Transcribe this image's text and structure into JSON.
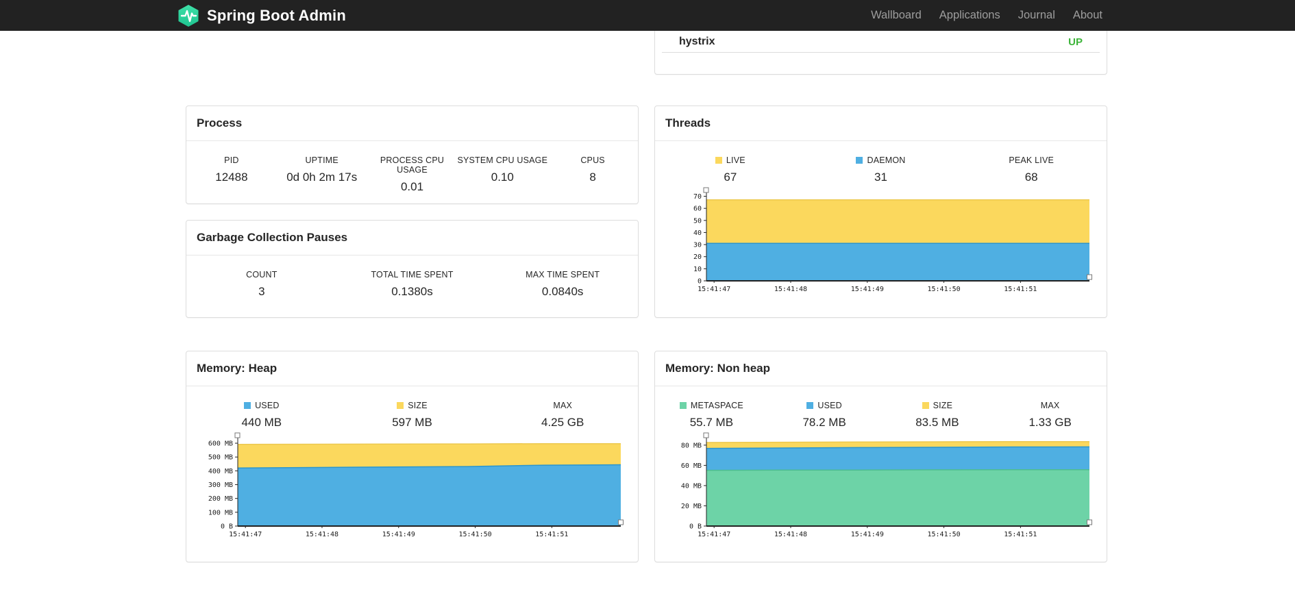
{
  "navbar": {
    "brand": "Spring Boot Admin",
    "links": [
      {
        "label": "Wallboard"
      },
      {
        "label": "Applications"
      },
      {
        "label": "Journal"
      },
      {
        "label": "About"
      }
    ]
  },
  "colors": {
    "accent_teal": "#2fd7a0",
    "status_up": "#3db43a",
    "series_yellow": "#fbd85d",
    "series_blue": "#4fafe2",
    "series_green": "#6dd3a7",
    "navbar_bg": "#222222"
  },
  "status_panel": {
    "service": "hystrix",
    "status": "UP"
  },
  "process": {
    "title": "Process",
    "metrics": [
      {
        "label": "PID",
        "value": "12488"
      },
      {
        "label": "UPTIME",
        "value": "0d 0h 2m 17s"
      },
      {
        "label": "PROCESS CPU USAGE",
        "value": "0.01"
      },
      {
        "label": "SYSTEM CPU USAGE",
        "value": "0.10"
      },
      {
        "label": "CPUS",
        "value": "8"
      }
    ]
  },
  "gc": {
    "title": "Garbage Collection Pauses",
    "metrics": [
      {
        "label": "COUNT",
        "value": "3"
      },
      {
        "label": "TOTAL TIME SPENT",
        "value": "0.1380s"
      },
      {
        "label": "MAX TIME SPENT",
        "value": "0.0840s"
      }
    ]
  },
  "threads": {
    "title": "Threads",
    "legend": [
      {
        "label": "LIVE",
        "value": "67",
        "swatch": "#fbd85d"
      },
      {
        "label": "DAEMON",
        "value": "31",
        "swatch": "#4fafe2"
      },
      {
        "label": "PEAK LIVE",
        "value": "68"
      }
    ]
  },
  "heap": {
    "title": "Memory: Heap",
    "legend": [
      {
        "label": "USED",
        "value": "440 MB",
        "swatch": "#4fafe2"
      },
      {
        "label": "SIZE",
        "value": "597 MB",
        "swatch": "#fbd85d"
      },
      {
        "label": "MAX",
        "value": "4.25 GB"
      }
    ]
  },
  "nonheap": {
    "title": "Memory: Non heap",
    "legend": [
      {
        "label": "METASPACE",
        "value": "55.7 MB",
        "swatch": "#6dd3a7"
      },
      {
        "label": "USED",
        "value": "78.2 MB",
        "swatch": "#4fafe2"
      },
      {
        "label": "SIZE",
        "value": "83.5 MB",
        "swatch": "#fbd85d"
      },
      {
        "label": "MAX",
        "value": "1.33 GB"
      }
    ]
  },
  "chart_data": [
    {
      "id": "threads",
      "type": "area",
      "title": "Threads",
      "legend_position": "top",
      "grid": false,
      "x_labels": [
        "15:41:47",
        "15:41:48",
        "15:41:49",
        "15:41:50",
        "15:41:51"
      ],
      "ylim": [
        0,
        72
      ],
      "yticks": [
        {
          "v": 0,
          "label": "0"
        },
        {
          "v": 10,
          "label": "10"
        },
        {
          "v": 20,
          "label": "20"
        },
        {
          "v": 30,
          "label": "30"
        },
        {
          "v": 40,
          "label": "40"
        },
        {
          "v": 50,
          "label": "50"
        },
        {
          "v": 60,
          "label": "60"
        },
        {
          "v": 70,
          "label": "70"
        }
      ],
      "series": [
        {
          "name": "LIVE",
          "color": "#fbd85d",
          "line": "#ecc84e",
          "values": [
            67,
            67,
            67,
            67,
            67,
            67
          ]
        },
        {
          "name": "DAEMON",
          "color": "#4fafe2",
          "line": "#2b95cd",
          "values": [
            31,
            31,
            31,
            31,
            31,
            31
          ]
        }
      ]
    },
    {
      "id": "heap",
      "type": "area",
      "title": "Memory: Heap",
      "legend_position": "top",
      "grid": false,
      "x_labels": [
        "15:41:47",
        "15:41:48",
        "15:41:49",
        "15:41:50",
        "15:41:51"
      ],
      "ylim": [
        0,
        630
      ],
      "yticks": [
        {
          "v": 0,
          "label": "0 B"
        },
        {
          "v": 100,
          "label": "100 MB"
        },
        {
          "v": 200,
          "label": "200 MB"
        },
        {
          "v": 300,
          "label": "300 MB"
        },
        {
          "v": 400,
          "label": "400 MB"
        },
        {
          "v": 500,
          "label": "500 MB"
        },
        {
          "v": 600,
          "label": "600 MB"
        }
      ],
      "series": [
        {
          "name": "SIZE",
          "color": "#fbd85d",
          "line": "#ecc84e",
          "values": [
            592,
            593,
            594,
            595,
            597,
            597
          ]
        },
        {
          "name": "USED",
          "color": "#4fafe2",
          "line": "#2b95cd",
          "values": [
            420,
            424,
            428,
            431,
            441,
            444
          ]
        }
      ]
    },
    {
      "id": "nonheap",
      "type": "area",
      "title": "Memory: Non heap",
      "legend_position": "top",
      "grid": false,
      "x_labels": [
        "15:41:47",
        "15:41:48",
        "15:41:49",
        "15:41:50",
        "15:41:51"
      ],
      "ylim": [
        0,
        86
      ],
      "yticks": [
        {
          "v": 0,
          "label": "0 B"
        },
        {
          "v": 20,
          "label": "20 MB"
        },
        {
          "v": 40,
          "label": "40 MB"
        },
        {
          "v": 60,
          "label": "60 MB"
        },
        {
          "v": 80,
          "label": "80 MB"
        }
      ],
      "series": [
        {
          "name": "SIZE",
          "color": "#fbd85d",
          "line": "#ecc84e",
          "values": [
            82.6,
            82.9,
            83.1,
            83.3,
            83.5,
            83.5
          ]
        },
        {
          "name": "USED",
          "color": "#4fafe2",
          "line": "#2b95cd",
          "values": [
            76.8,
            77.2,
            77.6,
            77.9,
            78.2,
            78.3
          ]
        },
        {
          "name": "METASPACE",
          "color": "#6dd3a7",
          "line": "#4dbd8f",
          "values": [
            55.1,
            55.3,
            55.4,
            55.6,
            55.7,
            55.7
          ]
        }
      ]
    }
  ]
}
